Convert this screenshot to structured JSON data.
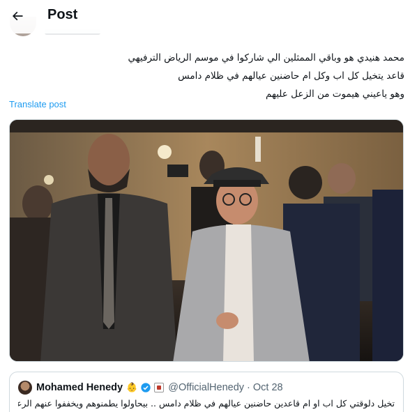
{
  "header": {
    "title": "Post",
    "back_icon": "arrow-left-icon"
  },
  "tweet": {
    "lines": [
      "محمد هنيدي هو وباقي الممثلين الي شاركوا في موسم الرياض الترفيهي",
      "قاعد يتخيل كل اب وكل ام حاضنين عيالهم في ظلام دامس",
      "وهو ياعيني هيموت من الزعل عليهم"
    ],
    "translate_label": "Translate post"
  },
  "quote": {
    "name": "Mohamed Henedy",
    "emoji": "👶",
    "handle": "@OfficialHenedy",
    "separator": "·",
    "date": "Oct 28",
    "text_line1": "تخيل دلوقتي كل اب او ام قاعدين حاضنين عيالهم في ظلام دامس .. بيحاولوا يطمنوهم ويخففوا عنهم الرعب من",
    "verified_color": "#1d9bf0"
  },
  "colors": {
    "link": "#1d9bf0",
    "muted": "#536471",
    "text": "#0f1419",
    "border": "#cfd9de"
  }
}
